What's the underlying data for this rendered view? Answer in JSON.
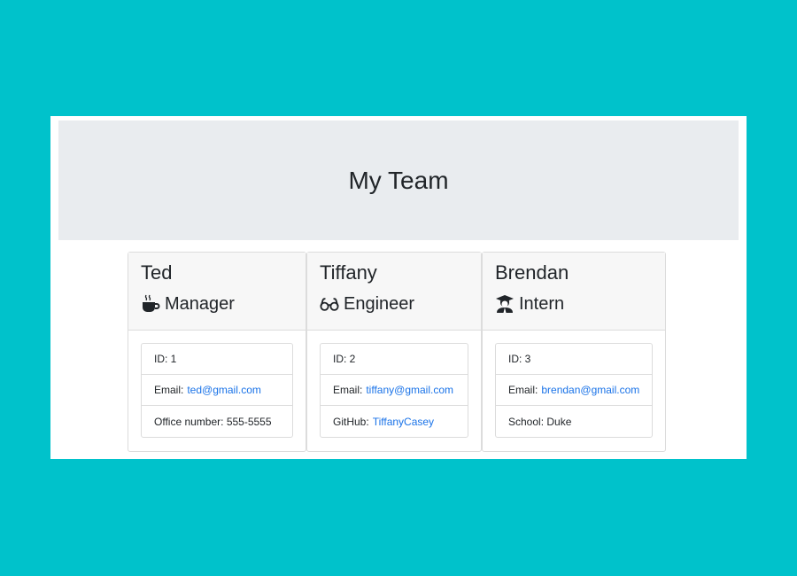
{
  "header": {
    "title": "My Team"
  },
  "colors": {
    "background": "#00c2cb",
    "link": "#1a73e8",
    "jumbotron": "#e9ecef"
  },
  "team": [
    {
      "name": "Ted",
      "role": "Manager",
      "role_icon": "coffee-mug-icon",
      "id_label": "ID: 1",
      "email_label": "Email:",
      "email": "ted@gmail.com",
      "extra_label": "Office number: 555-5555"
    },
    {
      "name": "Tiffany",
      "role": "Engineer",
      "role_icon": "glasses-icon",
      "id_label": "ID: 2",
      "email_label": "Email:",
      "email": "tiffany@gmail.com",
      "extra_label": "GitHub:",
      "extra_link": "TiffanyCasey"
    },
    {
      "name": "Brendan",
      "role": "Intern",
      "role_icon": "graduate-icon",
      "id_label": "ID: 3",
      "email_label": "Email:",
      "email": "brendan@gmail.com",
      "extra_label": "School: Duke"
    }
  ]
}
